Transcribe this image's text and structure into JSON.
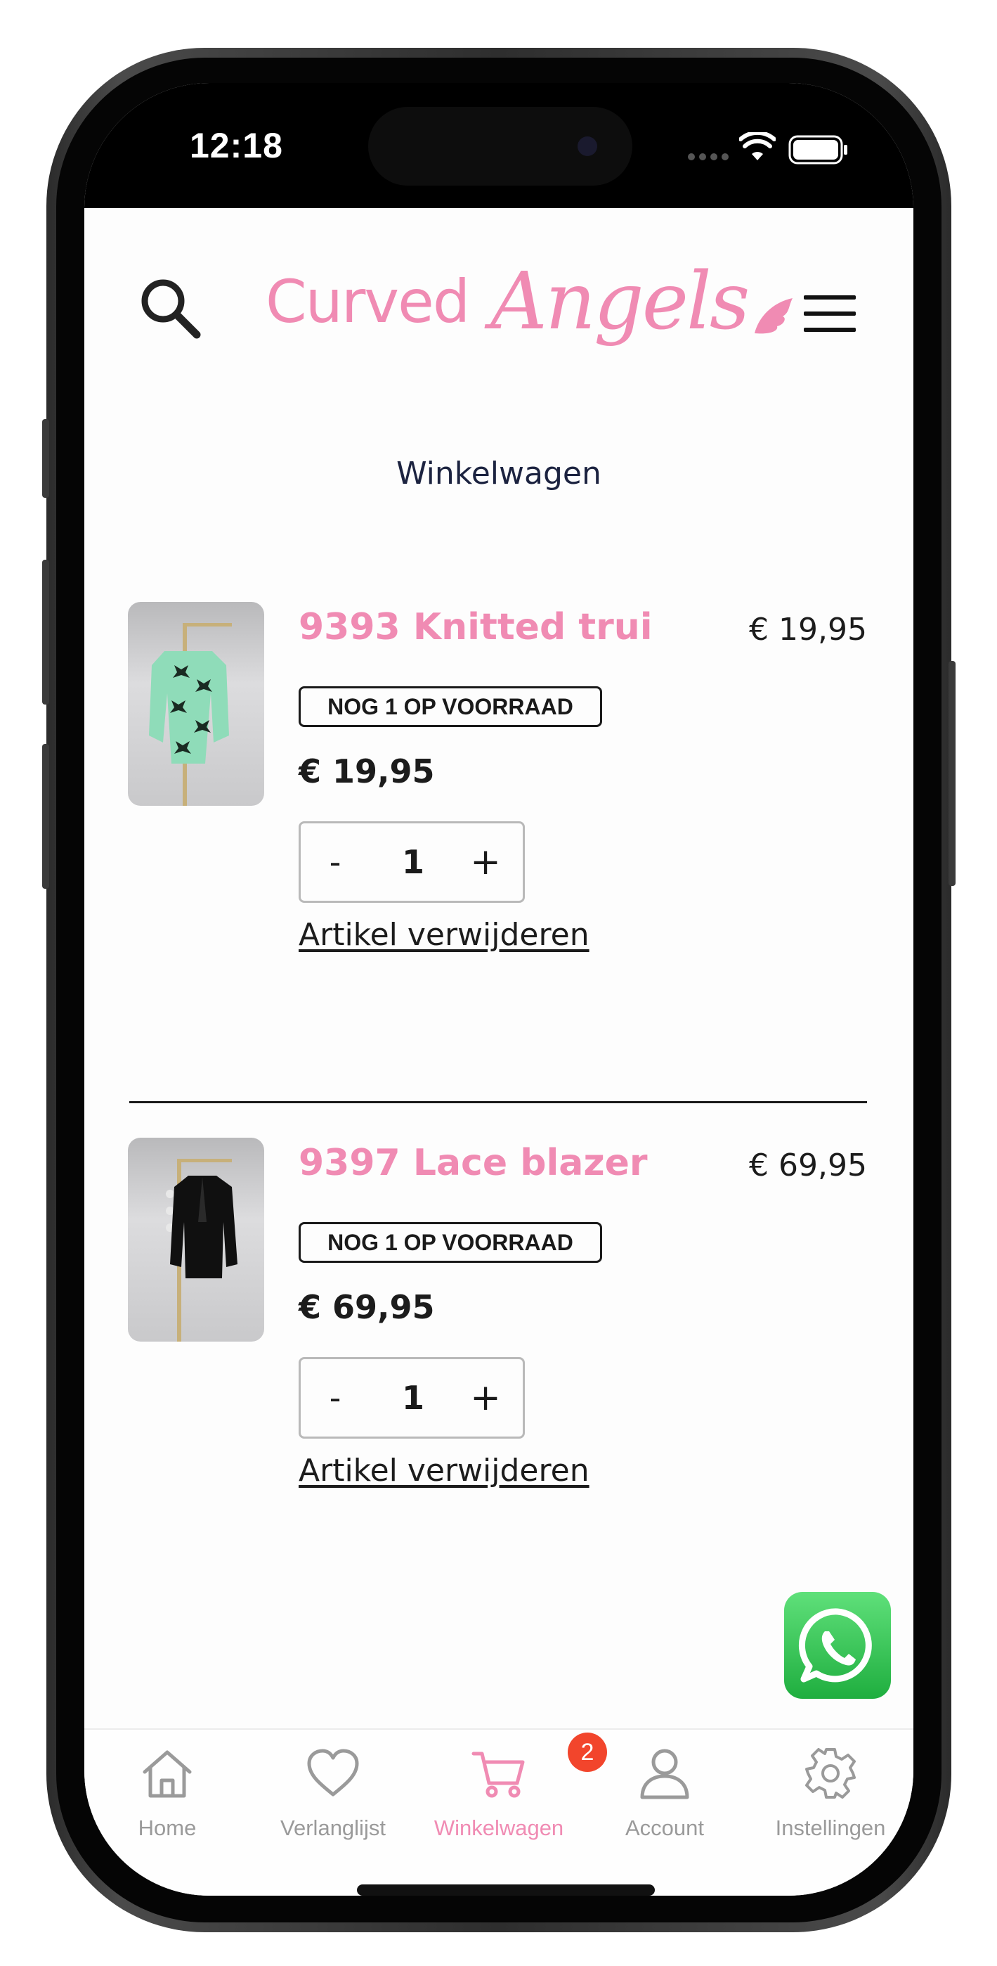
{
  "status_bar": {
    "time": "12:18"
  },
  "header": {
    "logo_part1": "Curved",
    "logo_part2": "Angels"
  },
  "page_title": "Winkelwagen",
  "cart_items": [
    {
      "name": "9393 Knitted trui",
      "line_total": "€ 19,95",
      "stock_badge": "NOG 1 OP VOORRAAD",
      "unit_price": "€ 19,95",
      "quantity": "1",
      "minus": "-",
      "plus": "+",
      "remove_label": "Artikel verwijderen",
      "thumb_color": "#8fdcb9"
    },
    {
      "name": "9397 Lace blazer",
      "line_total": "€ 69,95",
      "stock_badge": "NOG 1 OP VOORRAAD",
      "unit_price": "€ 69,95",
      "quantity": "1",
      "minus": "-",
      "plus": "+",
      "remove_label": "Artikel verwijderen",
      "thumb_color": "#101010"
    }
  ],
  "tab_bar": {
    "tabs": [
      {
        "label": "Home",
        "icon": "home-icon"
      },
      {
        "label": "Verlanglijst",
        "icon": "heart-icon"
      },
      {
        "label": "Winkelwagen",
        "icon": "cart-icon",
        "active": true
      },
      {
        "label": "Account",
        "icon": "user-icon"
      },
      {
        "label": "Instellingen",
        "icon": "gear-icon"
      }
    ],
    "cart_badge": "2"
  },
  "colors": {
    "brand_pink": "#f08bb3",
    "badge_red": "#f2452c",
    "whatsapp_green": "#25c04a"
  }
}
